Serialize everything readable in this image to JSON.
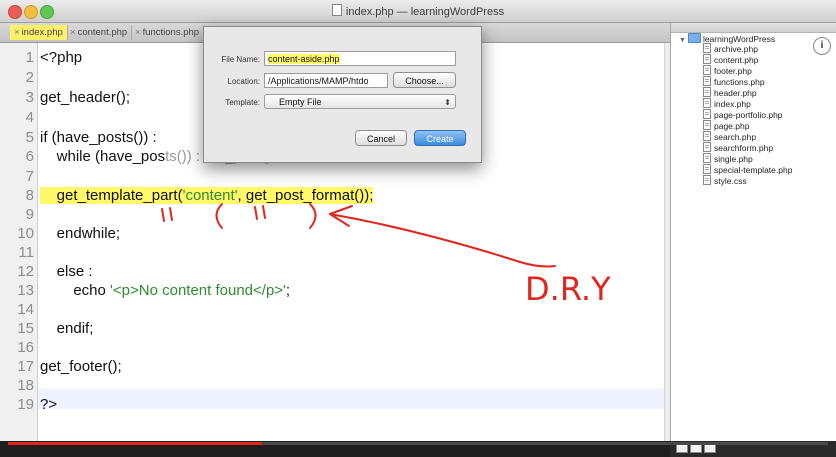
{
  "window": {
    "title": "index.php — learningWordPress"
  },
  "tabs": [
    {
      "label": "index.php",
      "active": true
    },
    {
      "label": "content.php",
      "active": false
    },
    {
      "label": "functions.php",
      "active": false
    }
  ],
  "code": {
    "line_numbers": [
      "1",
      "2",
      "3",
      "4",
      "5",
      "6",
      "7",
      "8",
      "9",
      "10",
      "11",
      "12",
      "13",
      "14",
      "15",
      "16",
      "17",
      "18",
      "19"
    ],
    "l1": "<?php",
    "l3": "get_header();",
    "l5": "if (have_posts()) :",
    "l6a": "    while (have_pos",
    "l6b": "ts()) : the_post();",
    "l8a": "    get_template_part(",
    "l8s1": "'content'",
    "l8b": ", get_post_format());",
    "l10": "    endwhile;",
    "l12": "    else :",
    "l13a": "        echo ",
    "l13s": "'<p>No content found</p>'",
    "l13b": ";",
    "l15": "    endif;",
    "l17": "get_footer();",
    "l19": "?>"
  },
  "dialog": {
    "file_name_label": "File Name:",
    "file_name_value": "content-aside.php",
    "location_label": "Location:",
    "location_value": "/Applications/MAMP/htdo",
    "choose_label": "Choose...",
    "template_label": "Template:",
    "template_value": "Empty File",
    "cancel_label": "Cancel",
    "create_label": "Create"
  },
  "project": {
    "root": "learningWordPress",
    "files": [
      "archive.php",
      "content.php",
      "footer.php",
      "functions.php",
      "header.php",
      "index.php",
      "page-portfolio.php",
      "page.php",
      "search.php",
      "searchform.php",
      "single.php",
      "special-template.php",
      "style.css"
    ]
  },
  "info_button": "i",
  "video": {
    "progress_fraction": 0.31
  },
  "colors": {
    "highlight": "#fff86a",
    "string": "#2e8b2e",
    "annotation": "#e0261f",
    "primary_button": "#3b8de0"
  },
  "annotation_text": "D.R.Y"
}
